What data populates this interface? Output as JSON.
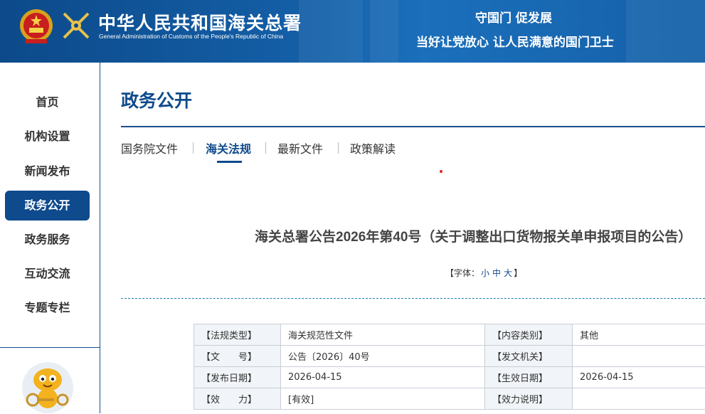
{
  "header": {
    "title": "中华人民共和国海关总署",
    "subtitle": "General Administration of Customs of the People's Republic of China",
    "slogan_line1": "守国门  促发展",
    "slogan_line2": "当好让党放心  让人民满意的国门卫士"
  },
  "sidebar": {
    "items": [
      {
        "label": "首页"
      },
      {
        "label": "机构设置"
      },
      {
        "label": "新闻发布"
      },
      {
        "label": "政务公开",
        "active": true
      },
      {
        "label": "政务服务"
      },
      {
        "label": "互动交流"
      },
      {
        "label": "专题专栏"
      }
    ]
  },
  "main": {
    "section_title": "政务公开",
    "tabs": [
      {
        "label": "国务院文件"
      },
      {
        "label": "海关法规",
        "active": true
      },
      {
        "label": "最新文件"
      },
      {
        "label": "政策解读"
      }
    ],
    "doc_title": "海关总署公告2026年第40号（关于调整出口货物报关单申报项目的公告）",
    "font_size": {
      "prefix": "【字体：",
      "small": "小",
      "medium": "中",
      "large": "大",
      "suffix": "】"
    },
    "meta": [
      {
        "l1": "【法规类型】",
        "v1": "海关规范性文件",
        "l2": "【内容类别】",
        "v2": "其他"
      },
      {
        "l1": "【文　　号】",
        "v1": "公告〔2026〕40号",
        "l2": "【发文机关】",
        "v2": ""
      },
      {
        "l1": "【发布日期】",
        "v1": "2026-04-15",
        "l2": "【生效日期】",
        "v2": "2026-04-15"
      },
      {
        "l1": "【效　　力】",
        "v1": "[有效]",
        "l2": "【效力说明】",
        "v2": ""
      }
    ]
  },
  "colors": {
    "primary": "#0e4a8c",
    "header_bg": "#1560a8",
    "accent_red": "#e02020"
  }
}
